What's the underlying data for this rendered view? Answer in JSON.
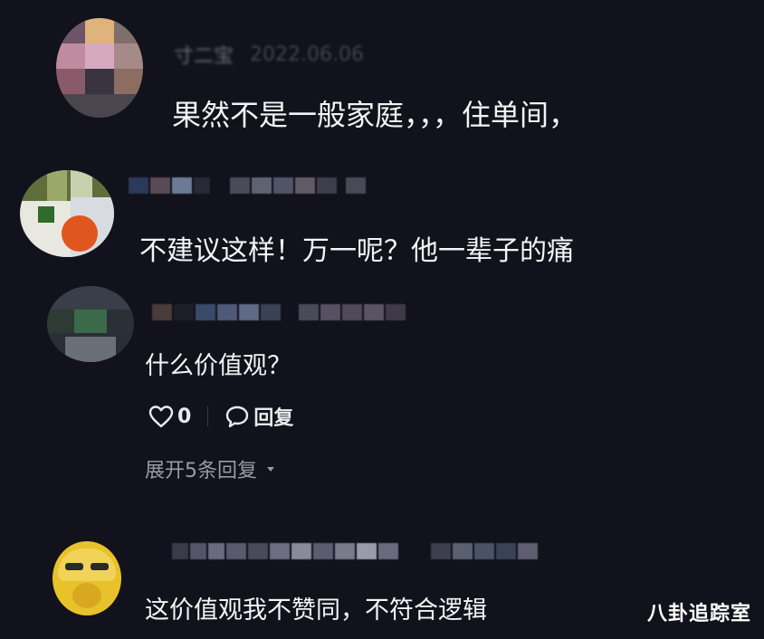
{
  "comments": [
    {
      "id": "c1",
      "username": "寸二宝",
      "timestamp": "2022.06.06",
      "text": "果然不是一般家庭，，，住单间，"
    },
    {
      "id": "c2",
      "text": "不建议这样！万一呢？他一辈子的痛"
    },
    {
      "id": "c3",
      "text": "什么价值观？",
      "likes": "0",
      "reply_label": "回复",
      "expand_label": "展开5条回复"
    },
    {
      "id": "c4",
      "text": "这价值观我不赞同，不符合逻辑"
    }
  ],
  "watermark": "八卦追踪室",
  "colors": {
    "background": "#12121c",
    "text": "#f4f4f6",
    "muted": "#9a9aa6"
  },
  "icons": {
    "like": "heart-outline-icon",
    "reply": "speech-bubble-icon",
    "expand": "caret-down-icon"
  }
}
